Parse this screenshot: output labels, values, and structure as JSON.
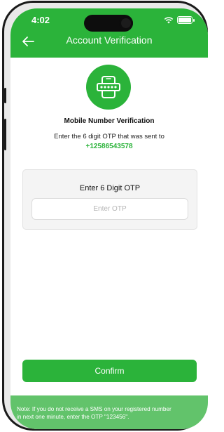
{
  "status_bar": {
    "time": "4:02",
    "icons": [
      "wifi-icon",
      "battery-icon"
    ]
  },
  "app_bar": {
    "title": "Account Verification",
    "back_icon": "arrow-left-icon"
  },
  "verification": {
    "icon": "phone-otp-icon",
    "heading": "Mobile Number  Verification",
    "instruction": "Enter the 6 digit OTP that was sent to",
    "phone_number": "+12586543578"
  },
  "otp_card": {
    "label": "Enter 6 Digit OTP",
    "input_placeholder": "Enter OTP",
    "input_value": ""
  },
  "confirm_label": "Confirm",
  "note": "Note:  If you do not receive a SMS on your registered number\nin next one minute, enter the OTP \"123456\".",
  "colors": {
    "primary": "#2bb33a",
    "note_bg": "#62c36b",
    "accent_text": "#2bb33a"
  }
}
